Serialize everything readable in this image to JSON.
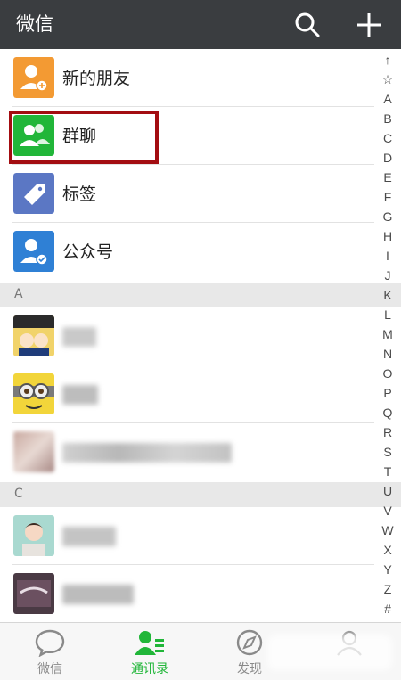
{
  "header": {
    "title": "微信"
  },
  "rows": [
    {
      "label": "新的朋友"
    },
    {
      "label": "群聊"
    },
    {
      "label": "标签"
    },
    {
      "label": "公众号"
    }
  ],
  "sections": [
    "A",
    "C"
  ],
  "index_letters": [
    "↑",
    "☆",
    "A",
    "B",
    "C",
    "D",
    "E",
    "F",
    "G",
    "H",
    "I",
    "J",
    "K",
    "L",
    "M",
    "N",
    "O",
    "P",
    "Q",
    "R",
    "S",
    "T",
    "U",
    "V",
    "W",
    "X",
    "Y",
    "Z",
    "#"
  ],
  "tabs": [
    {
      "label": "微信"
    },
    {
      "label": "通讯录"
    },
    {
      "label": "发现"
    },
    {
      "label": ""
    }
  ],
  "colors": {
    "topbar": "#3a3d40",
    "accent": "#21b639",
    "highlight": "#a30d11",
    "orange": "#f39a33",
    "blue": "#2f80d5",
    "tag": "#5b77c4"
  }
}
